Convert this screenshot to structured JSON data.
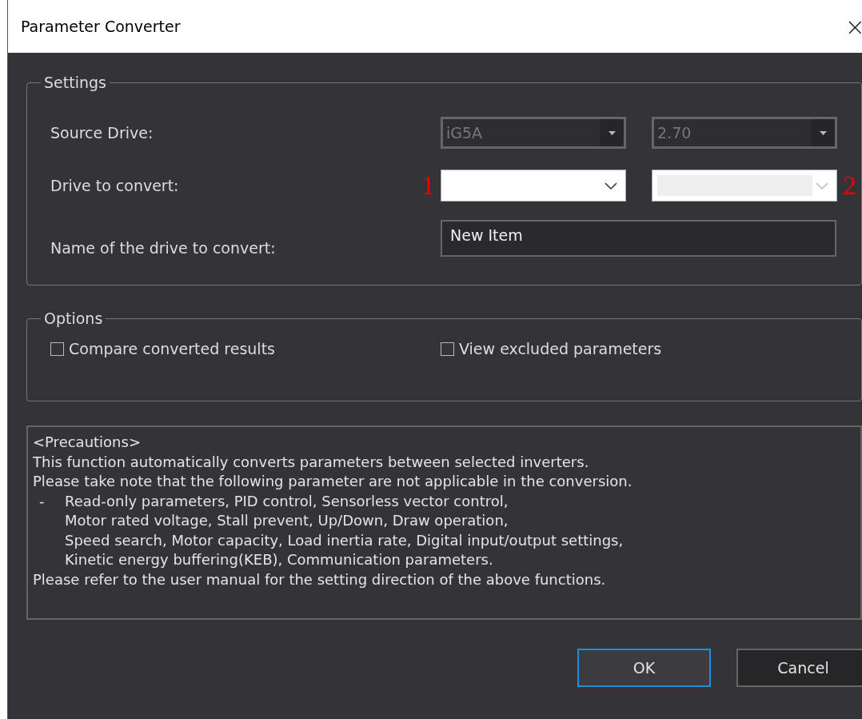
{
  "window": {
    "title": "Parameter Converter",
    "close": "×"
  },
  "settings": {
    "legend": "Settings",
    "rows": [
      {
        "kind": "pair",
        "label": "Source Drive:",
        "selects": [
          {
            "kind": "combo",
            "value": "iG5A",
            "disabled": true
          },
          {
            "kind": "combo",
            "value": "2.70",
            "disabled": true
          }
        ]
      },
      {
        "kind": "pair",
        "label": "Drive to convert:",
        "selects": [
          {
            "kind": "dropdown",
            "disabled": false,
            "annotation": "1"
          },
          {
            "kind": "dropdown",
            "disabled": true,
            "annotation": "2"
          }
        ]
      },
      {
        "kind": "text",
        "label": "Name of the drive to convert:",
        "value": "New Item"
      }
    ]
  },
  "options": {
    "legend": "Options",
    "checkboxes": [
      {
        "label": "Compare converted results",
        "checked": false
      },
      {
        "label": "View excluded parameters",
        "checked": false
      }
    ]
  },
  "precautions": [
    {
      "kind": "text",
      "text": "<Precautions>"
    },
    {
      "kind": "text",
      "text": "This function automatically converts parameters between selected inverters."
    },
    {
      "kind": "text",
      "text": "Please take note that the following parameter are not applicable in the conversion."
    },
    {
      "kind": "bullet",
      "marker": "-",
      "lines": [
        "Read-only parameters, PID control, Sensorless vector control,",
        "Motor rated voltage, Stall prevent, Up/Down, Draw operation,",
        "Speed search, Motor capacity, Load inertia rate, Digital input/output settings,",
        "Kinetic energy buffering(KEB), Communication parameters."
      ]
    },
    {
      "kind": "text",
      "text": "Please refer to the user manual for the setting direction of the above functions."
    }
  ],
  "buttons": [
    {
      "label": "OK",
      "focused": true
    },
    {
      "label": "Cancel",
      "focused": false
    }
  ]
}
